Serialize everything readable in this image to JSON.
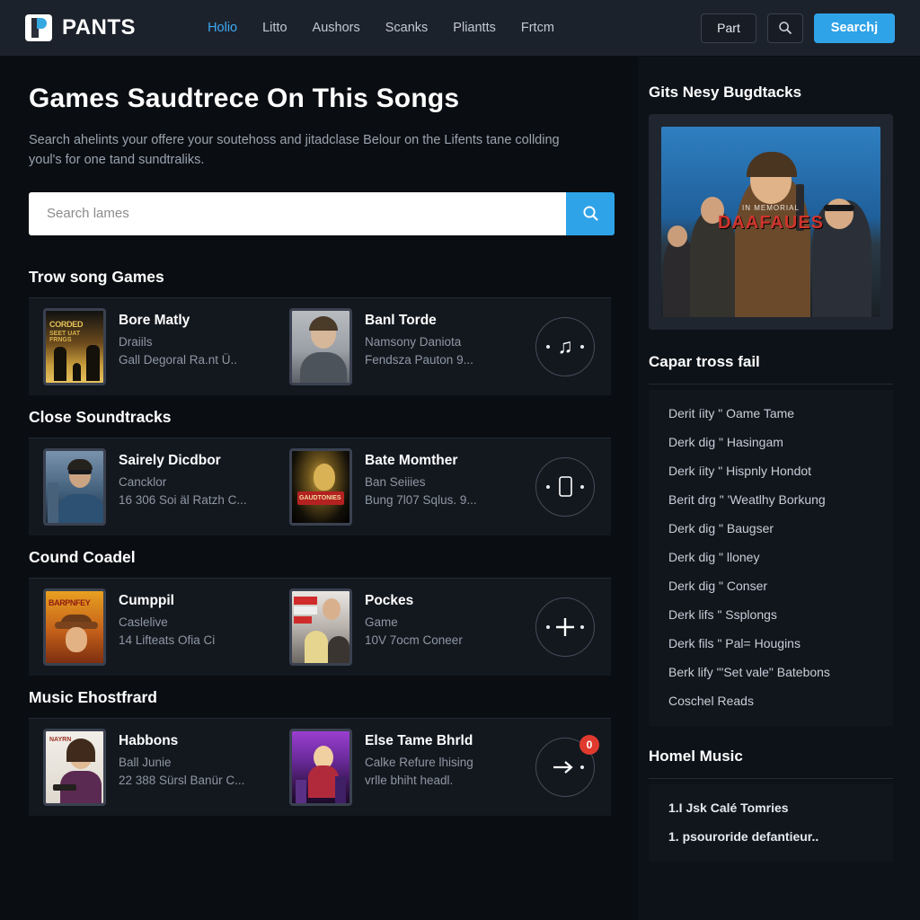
{
  "header": {
    "brand": "PANTS",
    "logo_icon": "logo-p-mark",
    "nav": [
      {
        "label": "Holio",
        "active": true
      },
      {
        "label": "Litto",
        "active": false
      },
      {
        "label": "Aushors",
        "active": false
      },
      {
        "label": "Scanks",
        "active": false
      },
      {
        "label": "Pliantts",
        "active": false
      },
      {
        "label": "Frtcm",
        "active": false
      }
    ],
    "part_button": "Part",
    "icon_button": "search-icon",
    "primary_button": "Searchj",
    "accent_color": "#2fa3e8"
  },
  "main": {
    "title": "Games Saudtrece On This Songs",
    "subtitle": "Search ahelints your offere your soutehoss and jitadclase Belour on the Lifents tane collding youl's for one tand sundtraliks.",
    "search": {
      "placeholder": "Search lames",
      "value": "",
      "button_icon": "search-icon"
    },
    "sections": [
      {
        "title": "Trow song Games",
        "action_icon": "music-note-icon",
        "badge": "",
        "items": [
          {
            "title": "Bore Matly",
            "line1": "Draiils",
            "line2": "Gall Degoral Ra.nt  Ü..",
            "art": "poster-corded"
          },
          {
            "title": "Banl Torde",
            "line1": "Namsony Daniota",
            "line2": "Fendsza Pauton 9...",
            "art": "photo-portrait"
          }
        ]
      },
      {
        "title": "Close Soundtracks",
        "action_icon": "phone-icon",
        "badge": "",
        "items": [
          {
            "title": "Sairely Dicdbor",
            "line1": "Cancklor",
            "line2": "16 306 Soi äl Ratzh C...",
            "art": "poster-city"
          },
          {
            "title": "Bate Momther",
            "line1": "Ban Seiiies",
            "line2": "Bung 7l07 Sqlus.  9...",
            "art": "poster-gold"
          }
        ]
      },
      {
        "title": "Cound Coadel",
        "action_icon": "plus-icon",
        "badge": "",
        "items": [
          {
            "title": "Cumppil",
            "line1": "Caslelive",
            "line2": "14 Lifteats Ofia Ci",
            "art": "poster-orange"
          },
          {
            "title": "Pockes",
            "line1": "Game",
            "line2": "10V 7ocm Coneer",
            "art": "poster-group"
          }
        ]
      },
      {
        "title": "Music Ehostfrard",
        "action_icon": "arrow-right-icon",
        "badge": "0",
        "items": [
          {
            "title": "Habbons",
            "line1": "Ball Junie",
            "line2": "22 388 Sürsl Banür C...",
            "art": "poster-woman"
          },
          {
            "title": "Else Tame Bhrld",
            "line1": "Calke Refure lhising",
            "line2": "vrlle bhiht headl.",
            "art": "poster-purple"
          }
        ]
      }
    ]
  },
  "sidebar": {
    "featured": {
      "title": "Gits Nesy Bugdtacks",
      "poster_kicker": "IN MEMORIAL",
      "poster_title": "DAAFAUES"
    },
    "list_one": {
      "title": "Capar tross fail",
      "items": [
        "Derit íity \" Oame Tame",
        "Derk dig \" Hasingam",
        "Derk íity \" Hispnly Hondot",
        "Berit drg \" 'Weatlhy Borkung",
        "Derk dig \" Baugser",
        "Derk dig \" lloney",
        "Derk dig \" Conser",
        "Derk lifs \" Ssplongs",
        "Derk fils \" Pal= Hougins",
        "Berk lify \"'Set vale\" Batebons",
        "Coschel Reads"
      ]
    },
    "list_two": {
      "title": "Homel Music",
      "items": [
        "1.I Jsk Calé Tomries",
        "1. psouroride defantieur.."
      ]
    }
  }
}
